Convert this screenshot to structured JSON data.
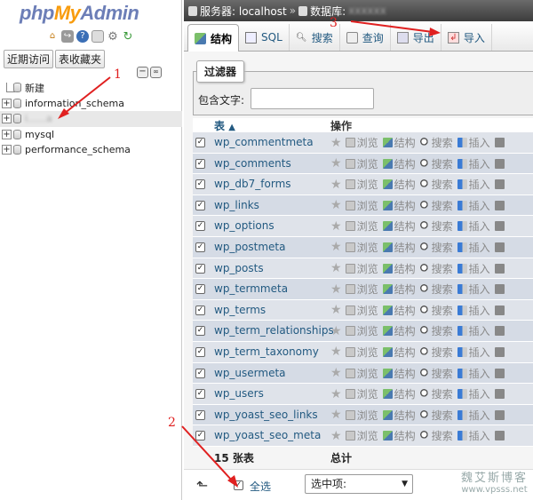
{
  "logo": {
    "php": "php",
    "my": "My",
    "admin": "Admin"
  },
  "nav": {
    "icons": [
      "home-icon",
      "exit-icon",
      "help-icon",
      "docs-icon",
      "settings-icon",
      "reload-icon"
    ],
    "tabs": [
      "近期访问",
      "表收藏夹"
    ],
    "tree": [
      {
        "label": "新建",
        "type": "new"
      },
      {
        "label": "information_schema",
        "type": "db"
      },
      {
        "label": "i......a",
        "type": "db",
        "selected": true,
        "blurred": true
      },
      {
        "label": "mysql",
        "type": "db"
      },
      {
        "label": "performance_schema",
        "type": "db"
      }
    ]
  },
  "breadcrumb": {
    "server": "服务器: localhost",
    "sep": "»",
    "db": "数据库: "
  },
  "tabs": [
    {
      "label": "结构",
      "icon": "structure-icon",
      "active": true
    },
    {
      "label": "SQL",
      "icon": "sql-icon"
    },
    {
      "label": "搜索",
      "icon": "search-icon"
    },
    {
      "label": "查询",
      "icon": "query-icon"
    },
    {
      "label": "导出",
      "icon": "export-icon"
    },
    {
      "label": "导入",
      "icon": "import-icon"
    }
  ],
  "filter": {
    "legend": "过滤器",
    "label": "包含文字:",
    "value": ""
  },
  "table": {
    "header_name": "表",
    "sort_glyph": "▲",
    "header_ops": "操作",
    "ops": [
      "浏览",
      "结构",
      "搜索",
      "插入"
    ],
    "rows": [
      "wp_commentmeta",
      "wp_comments",
      "wp_db7_forms",
      "wp_links",
      "wp_options",
      "wp_postmeta",
      "wp_posts",
      "wp_termmeta",
      "wp_terms",
      "wp_term_relationships",
      "wp_term_taxonomy",
      "wp_usermeta",
      "wp_users",
      "wp_yoast_seo_links",
      "wp_yoast_seo_meta"
    ],
    "footer_count": "15 张表",
    "footer_sum": "总计"
  },
  "bottom": {
    "check_all": "全选",
    "with_selected": "选中项:"
  },
  "annotations": {
    "n1": "1",
    "n2": "2",
    "n3": "3"
  },
  "watermark": {
    "line1": "魏艾斯博客",
    "line2": "www.vpsss.net"
  }
}
